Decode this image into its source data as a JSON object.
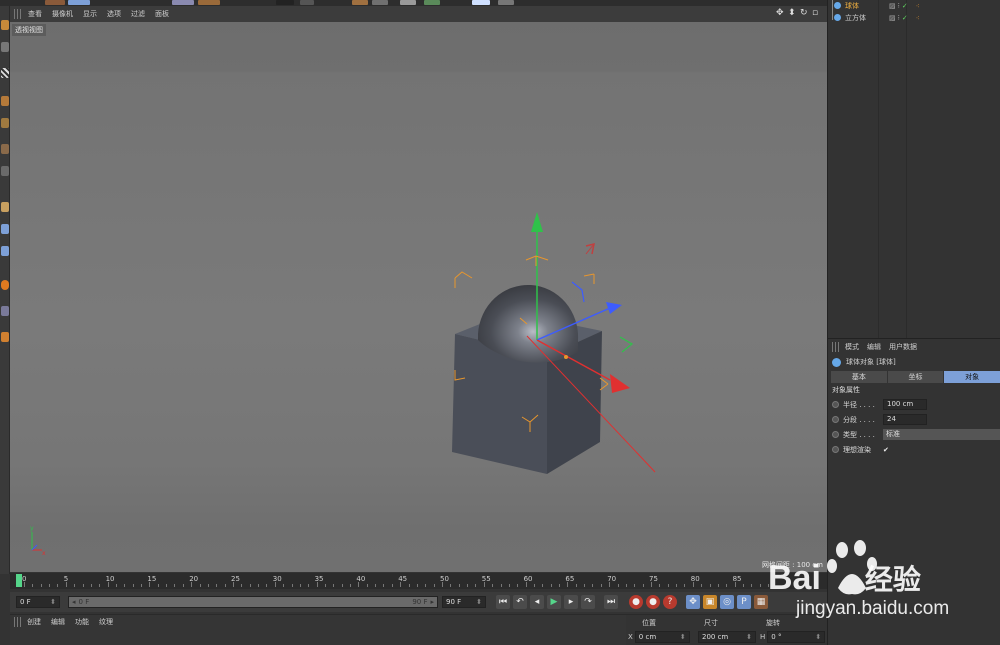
{
  "colors": {
    "accent": "#7da0d8",
    "playhead": "#55d58a",
    "axis_x": "#e03030",
    "axis_y": "#2fc24a",
    "axis_z": "#3d5cff",
    "handle_orange": "#e8962d"
  },
  "viewport": {
    "menu": [
      "查看",
      "摄像机",
      "显示",
      "选项",
      "过滤",
      "面板"
    ],
    "label": "透视视图",
    "grid_info": "网格间距 : 100 cm",
    "nav_icons": [
      "move-view-icon",
      "zoom-view-icon",
      "rotate-view-icon",
      "maximize-icon"
    ]
  },
  "timeline": {
    "ticks": [
      "0",
      "5",
      "10",
      "15",
      "20",
      "25",
      "30",
      "35",
      "40",
      "45",
      "50",
      "55",
      "60",
      "65",
      "70",
      "75",
      "80",
      "85"
    ]
  },
  "transport": {
    "current_frame": "0 F",
    "range_start": "0 F",
    "range_end": "90 F",
    "max_frame": "90 F"
  },
  "bottom_menu": [
    "创建",
    "编辑",
    "功能",
    "纹理"
  ],
  "coordinates": {
    "headers": [
      "位置",
      "尺寸",
      "旋转"
    ],
    "x_label": "X",
    "x_value": "0 cm",
    "size_x_value": "200 cm",
    "h_label": "H",
    "h_value": "0 °"
  },
  "objects": [
    {
      "name": "球体"
    },
    {
      "name": "立方体"
    }
  ],
  "attributes": {
    "menu": [
      "模式",
      "编辑",
      "用户数据"
    ],
    "title": "球体对象 [球体]",
    "tabs": [
      "基本",
      "坐标",
      "对象"
    ],
    "active_tab": "对象",
    "section": "对象属性",
    "rows": [
      {
        "label": "半径 . . . .",
        "value": "100 cm"
      },
      {
        "label": "分段 . . . .",
        "value": "24"
      },
      {
        "label": "类型 . . . .",
        "value": "标准"
      },
      {
        "label": "理想渲染",
        "value": "✔"
      }
    ]
  },
  "watermark": {
    "brand": "Bai",
    "brand_cn": "经验",
    "url": "jingyan.baidu.com"
  }
}
